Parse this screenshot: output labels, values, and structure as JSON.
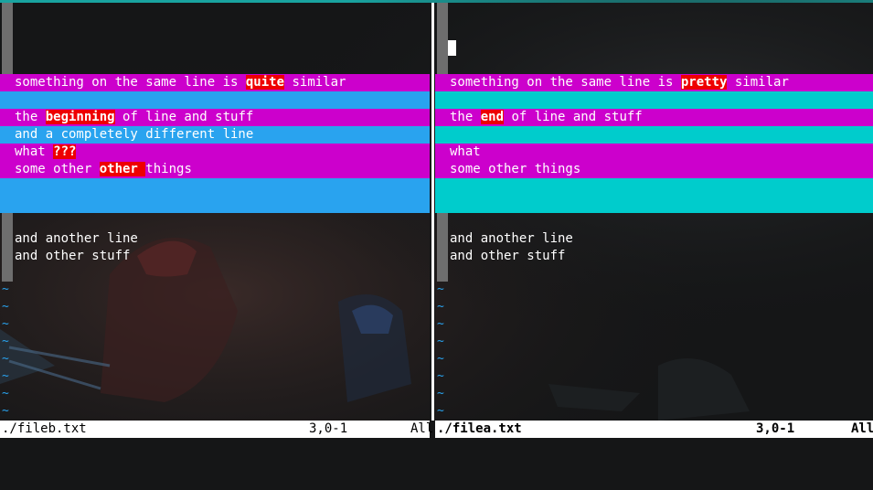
{
  "left_pane": {
    "lines": [
      {
        "segments": [
          "something on the same line is ",
          "quite",
          " similar"
        ]
      },
      {
        "segments": [
          "the ",
          "beginning",
          " of line and stuff"
        ]
      },
      {
        "segments": [
          "and a completely different line"
        ]
      },
      {
        "segments": [
          "what ",
          "???"
        ]
      },
      {
        "segments": [
          "some other ",
          "other ",
          "things"
        ]
      },
      {
        "segments": [
          "and another line"
        ]
      },
      {
        "segments": [
          "and other stuff"
        ]
      }
    ],
    "status": {
      "filename": "./fileb.txt",
      "position": "3,0-1",
      "scroll": "All"
    }
  },
  "right_pane": {
    "lines": [
      {
        "segments": [
          "something on the same line is ",
          "pretty",
          " similar"
        ]
      },
      {
        "segments": [
          "the ",
          "end",
          " of line and stuff"
        ]
      },
      {
        "segments": [
          "what"
        ]
      },
      {
        "segments": [
          "some other things"
        ]
      },
      {
        "segments": [
          "and another line"
        ]
      },
      {
        "segments": [
          "and other stuff"
        ]
      }
    ],
    "status": {
      "filename": "./filea.txt",
      "position": "3,0-1",
      "scroll": "All"
    }
  },
  "empty_line_marker": "~",
  "colors": {
    "changed_line": "#cc00cc",
    "added_line_left": "#29a3ef",
    "filler_line_right": "#00cccc",
    "changed_text": "#ee0000",
    "accent": "#19a3a0"
  }
}
